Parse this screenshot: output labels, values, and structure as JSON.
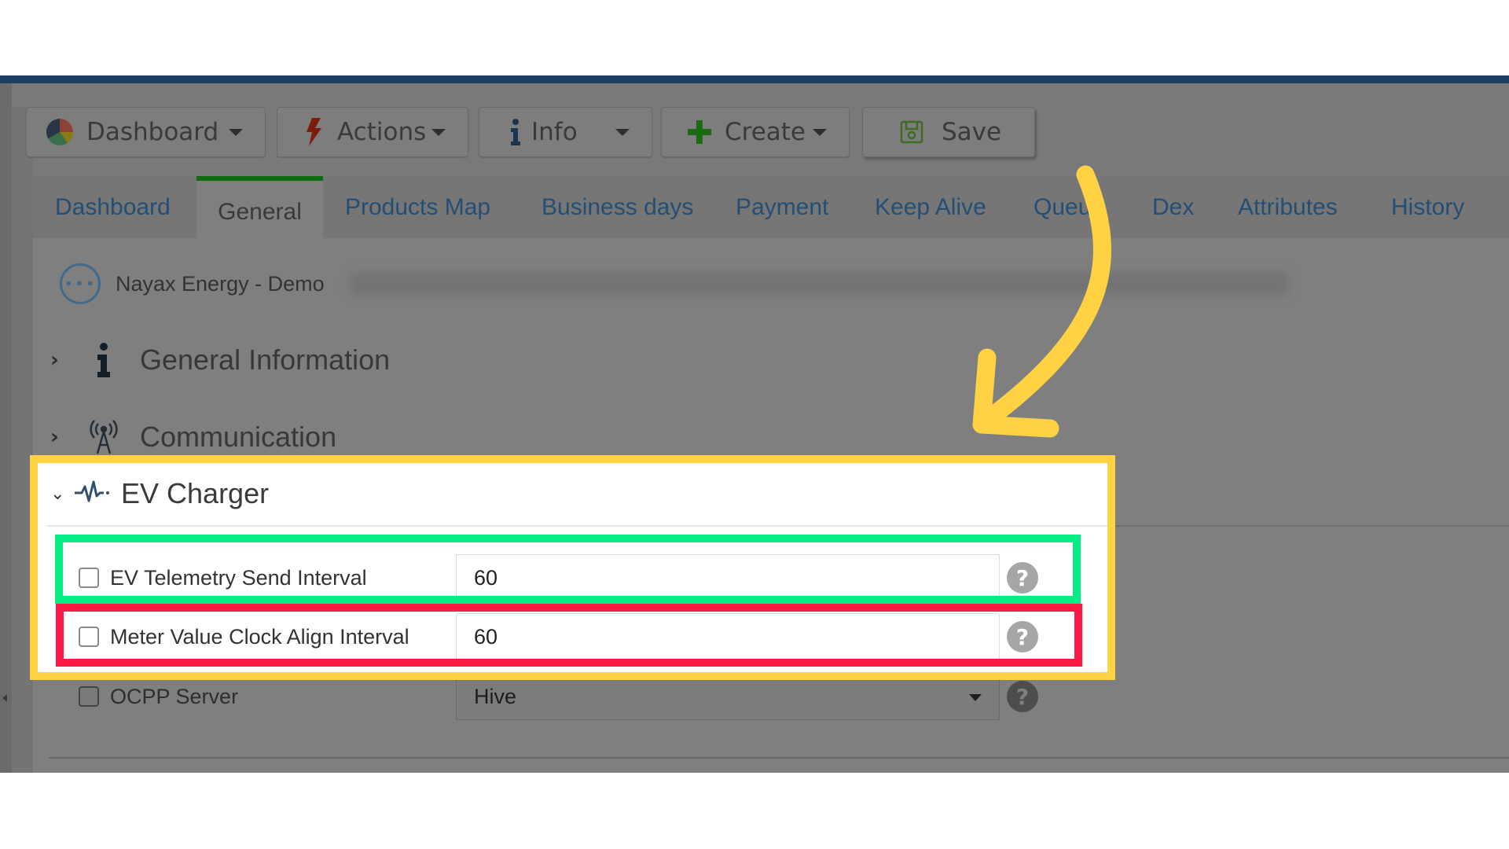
{
  "toolbar": {
    "buttons": [
      {
        "label": "Dashboard",
        "icon": "pie-chart-icon",
        "has_dropdown": true
      },
      {
        "label": "Actions",
        "icon": "lightning-icon",
        "has_dropdown": true
      },
      {
        "label": "Info",
        "icon": "info-icon",
        "has_dropdown": true
      },
      {
        "label": "Create",
        "icon": "plus-icon",
        "has_dropdown": true
      },
      {
        "label": "Save",
        "icon": "floppy-disk-icon",
        "has_dropdown": false
      }
    ]
  },
  "tabs": {
    "active": "General",
    "items": [
      {
        "label": "Dashboard"
      },
      {
        "label": "General"
      },
      {
        "label": "Products Map"
      },
      {
        "label": "Business days"
      },
      {
        "label": "Payment"
      },
      {
        "label": "Keep Alive"
      },
      {
        "label": "Queue"
      },
      {
        "label": "Dex"
      },
      {
        "label": "Attributes"
      },
      {
        "label": "History"
      }
    ]
  },
  "device": {
    "name": "Nayax Energy - Demo",
    "menu_icon": "more-dots-icon"
  },
  "sections": [
    {
      "title": "General Information",
      "icon": "info-icon",
      "expanded": false
    },
    {
      "title": "Communication",
      "icon": "antenna-icon",
      "expanded": false
    },
    {
      "title": "EV Charger",
      "icon": "pulse-icon",
      "expanded": true
    }
  ],
  "ev_charger": {
    "fields": [
      {
        "label": "EV Telemetry Send Interval",
        "value": "60",
        "checked": false,
        "highlight": "green"
      },
      {
        "label": "Meter Value Clock Align Interval",
        "value": "60",
        "checked": false,
        "highlight": "red"
      },
      {
        "label": "OCPP Server",
        "value": "Hive",
        "checked": false,
        "type": "select"
      }
    ]
  },
  "annotations": {
    "colors": {
      "yellow": "#ffd244",
      "green": "#06ec85",
      "red": "#ff1a45",
      "arrow": "#ffd244"
    }
  },
  "colors": {
    "top_bar": "#1b3f5e",
    "tab_active_indicator": "#0f6b0f",
    "tab_link": "#244e73"
  }
}
